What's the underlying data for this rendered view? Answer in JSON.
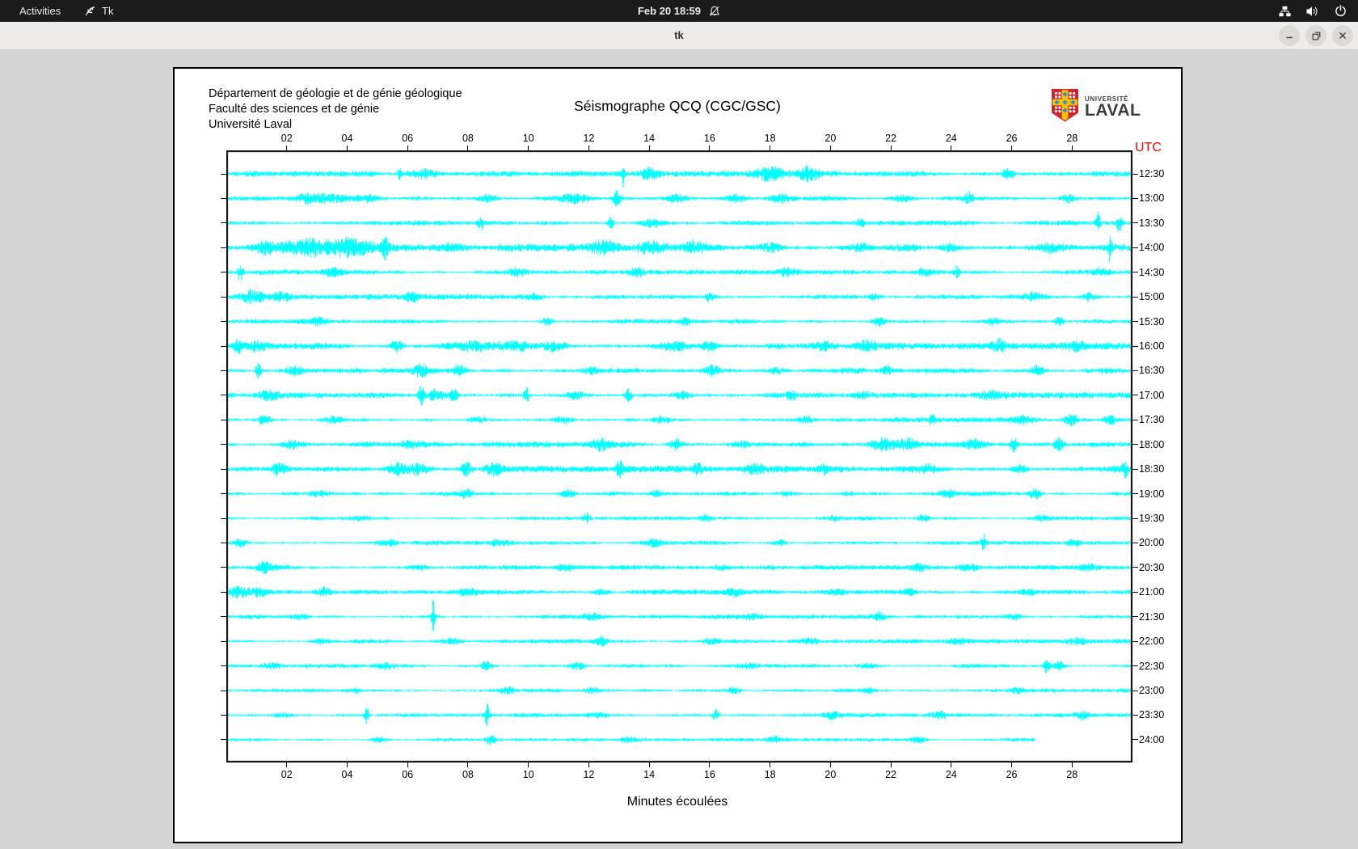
{
  "top_bar": {
    "activities": "Activities",
    "app_name": "Tk",
    "clock": "Feb 20 18:59",
    "icons": [
      "tk-icon",
      "notifications-muted-icon",
      "network-wired-icon",
      "volume-icon",
      "power-icon"
    ]
  },
  "titlebar": {
    "title": "tk",
    "buttons": [
      "minimize",
      "maximize",
      "close"
    ]
  },
  "seismograph": {
    "header_lines": [
      "Département de géologie et de génie géologique",
      "Faculté des sciences et de génie",
      "Université Laval"
    ],
    "title": "Séismographe QCQ (CGC/GSC)",
    "logo": {
      "line1": "UNIVERSITÉ",
      "line2": "LAVAL"
    },
    "utc_label": "UTC",
    "xlabel": "Minutes écoulées",
    "colors": {
      "trace": "#00ffff",
      "utc": "#f40000",
      "axis": "#000000",
      "logo_red": "#d5202e",
      "logo_gold": "#f6c101",
      "logo_blue": "#2792cc"
    }
  },
  "chart_data": {
    "type": "line",
    "title": "Séismographe QCQ (CGC/GSC)",
    "xlabel": "Minutes écoulées",
    "x_range": [
      0,
      30
    ],
    "x_ticks": [
      "02",
      "04",
      "06",
      "08",
      "10",
      "12",
      "14",
      "16",
      "18",
      "20",
      "22",
      "24",
      "26",
      "28"
    ],
    "utc_start": "12:30",
    "utc_end": "24:00",
    "minutes_per_line": 30,
    "rows": [
      {
        "label": "12:30",
        "amp": 2.4,
        "end": 30,
        "events": [
          [
            5.7,
            14,
            0.06
          ],
          [
            6.5,
            6,
            0.5
          ],
          [
            13.1,
            16,
            0.05
          ],
          [
            14.0,
            5,
            0.3
          ],
          [
            18.0,
            7,
            0.5
          ],
          [
            19.3,
            8,
            0.3
          ],
          [
            25.9,
            5,
            0.2
          ]
        ]
      },
      {
        "label": "13:00",
        "amp": 2.4,
        "end": 30,
        "events": [
          [
            2.6,
            5,
            0.4
          ],
          [
            3.4,
            6,
            0.5
          ],
          [
            4.6,
            5,
            0.4
          ],
          [
            8.6,
            4,
            0.3
          ],
          [
            11.5,
            6,
            0.5
          ],
          [
            12.9,
            9,
            0.15
          ],
          [
            14.9,
            5,
            0.4
          ],
          [
            16.9,
            5,
            0.3
          ],
          [
            18.4,
            5,
            0.3
          ],
          [
            22.4,
            4,
            0.3
          ],
          [
            24.6,
            7,
            0.15
          ],
          [
            27.9,
            5,
            0.2
          ]
        ]
      },
      {
        "label": "13:30",
        "amp": 2.1,
        "end": 30,
        "events": [
          [
            8.4,
            8,
            0.1
          ],
          [
            12.7,
            7,
            0.1
          ],
          [
            14.1,
            5,
            0.4
          ],
          [
            21.0,
            4,
            0.2
          ],
          [
            28.9,
            14,
            0.07
          ],
          [
            29.6,
            10,
            0.1
          ]
        ]
      },
      {
        "label": "14:00",
        "amp": 3.2,
        "end": 30,
        "events": [
          [
            1.2,
            6,
            0.4
          ],
          [
            2.5,
            8,
            0.8
          ],
          [
            4.0,
            9,
            0.7
          ],
          [
            5.2,
            12,
            0.12
          ],
          [
            7.5,
            5,
            0.5
          ],
          [
            12.5,
            7,
            0.6
          ],
          [
            14.0,
            6,
            0.4
          ],
          [
            15.5,
            6,
            0.3
          ],
          [
            18.0,
            5,
            0.4
          ],
          [
            21.0,
            5,
            0.3
          ],
          [
            24.0,
            5,
            0.3
          ],
          [
            27.3,
            5,
            0.3
          ],
          [
            29.3,
            16,
            0.06
          ]
        ]
      },
      {
        "label": "14:30",
        "amp": 2.1,
        "end": 30,
        "events": [
          [
            0.4,
            10,
            0.1
          ],
          [
            3.5,
            4,
            0.3
          ],
          [
            9.6,
            5,
            0.3
          ],
          [
            13.6,
            5,
            0.25
          ],
          [
            18.6,
            5,
            0.3
          ],
          [
            23.1,
            4,
            0.3
          ],
          [
            24.2,
            8,
            0.1
          ],
          [
            29.0,
            4,
            0.2
          ]
        ]
      },
      {
        "label": "15:00",
        "amp": 2.4,
        "end": 30,
        "events": [
          [
            0.8,
            7,
            0.4
          ],
          [
            1.8,
            5,
            0.3
          ],
          [
            6.1,
            5,
            0.2
          ],
          [
            10.2,
            4,
            0.25
          ],
          [
            16.0,
            4,
            0.2
          ],
          [
            21.4,
            4,
            0.2
          ],
          [
            26.8,
            5,
            0.3
          ],
          [
            28.6,
            5,
            0.25
          ]
        ]
      },
      {
        "label": "15:30",
        "amp": 2.1,
        "end": 30,
        "events": [
          [
            3.0,
            4,
            0.3
          ],
          [
            10.6,
            5,
            0.2
          ],
          [
            15.2,
            4,
            0.2
          ],
          [
            21.6,
            5,
            0.2
          ],
          [
            25.4,
            4,
            0.2
          ],
          [
            27.6,
            6,
            0.15
          ]
        ]
      },
      {
        "label": "16:00",
        "amp": 3.0,
        "end": 30,
        "events": [
          [
            0.3,
            8,
            0.15
          ],
          [
            1.0,
            6,
            0.3
          ],
          [
            5.6,
            7,
            0.2
          ],
          [
            8.0,
            5,
            0.8
          ],
          [
            9.5,
            6,
            0.6
          ],
          [
            10.8,
            6,
            0.4
          ],
          [
            14.8,
            5,
            0.5
          ],
          [
            16.0,
            5,
            0.3
          ],
          [
            19.8,
            5,
            0.4
          ],
          [
            21.2,
            5,
            0.3
          ],
          [
            25.6,
            6,
            0.2
          ],
          [
            28.2,
            4,
            0.3
          ]
        ]
      },
      {
        "label": "16:30",
        "amp": 2.4,
        "end": 30,
        "events": [
          [
            1.0,
            12,
            0.08
          ],
          [
            2.2,
            5,
            0.3
          ],
          [
            6.4,
            7,
            0.25
          ],
          [
            7.7,
            6,
            0.2
          ],
          [
            12.1,
            4,
            0.3
          ],
          [
            16.1,
            6,
            0.25
          ],
          [
            18.2,
            4,
            0.3
          ],
          [
            21.9,
            5,
            0.2
          ],
          [
            26.9,
            6,
            0.2
          ]
        ]
      },
      {
        "label": "17:00",
        "amp": 2.5,
        "end": 30,
        "events": [
          [
            1.3,
            5,
            0.3
          ],
          [
            6.4,
            14,
            0.1
          ],
          [
            6.9,
            7,
            0.3
          ],
          [
            7.5,
            8,
            0.15
          ],
          [
            9.9,
            11,
            0.08
          ],
          [
            11.5,
            5,
            0.3
          ],
          [
            13.3,
            8,
            0.12
          ],
          [
            15.1,
            4,
            0.3
          ],
          [
            18.7,
            7,
            0.15
          ],
          [
            21.2,
            4,
            0.3
          ],
          [
            25.3,
            5,
            0.4
          ]
        ]
      },
      {
        "label": "17:30",
        "amp": 2.1,
        "end": 30,
        "events": [
          [
            1.2,
            5,
            0.25
          ],
          [
            3.5,
            4,
            0.3
          ],
          [
            8.3,
            4,
            0.3
          ],
          [
            11.1,
            5,
            0.3
          ],
          [
            14.4,
            4,
            0.3
          ],
          [
            19.2,
            4,
            0.25
          ],
          [
            23.4,
            8,
            0.1
          ],
          [
            26.4,
            4,
            0.3
          ],
          [
            28.0,
            7,
            0.2
          ],
          [
            29.3,
            6,
            0.2
          ]
        ]
      },
      {
        "label": "18:00",
        "amp": 2.4,
        "end": 30,
        "events": [
          [
            2.1,
            4,
            0.3
          ],
          [
            6.1,
            4,
            0.3
          ],
          [
            12.4,
            7,
            0.3
          ],
          [
            14.9,
            6,
            0.2
          ],
          [
            17.0,
            4,
            0.3
          ],
          [
            21.7,
            7,
            0.4
          ],
          [
            22.6,
            6,
            0.3
          ],
          [
            24.8,
            5,
            0.3
          ],
          [
            26.1,
            8,
            0.12
          ],
          [
            27.6,
            7,
            0.15
          ]
        ]
      },
      {
        "label": "18:30",
        "amp": 2.8,
        "end": 30,
        "events": [
          [
            1.7,
            6,
            0.25
          ],
          [
            5.6,
            8,
            0.3
          ],
          [
            6.3,
            7,
            0.4
          ],
          [
            7.9,
            8,
            0.2
          ],
          [
            8.8,
            6,
            0.3
          ],
          [
            13.0,
            9,
            0.12
          ],
          [
            15.6,
            7,
            0.15
          ],
          [
            17.5,
            5,
            0.3
          ],
          [
            19.8,
            6,
            0.15
          ],
          [
            23.3,
            4,
            0.3
          ],
          [
            26.3,
            5,
            0.25
          ],
          [
            29.8,
            9,
            0.1
          ]
        ]
      },
      {
        "label": "19:00",
        "amp": 2.0,
        "end": 30,
        "events": [
          [
            3.0,
            3,
            0.3
          ],
          [
            7.9,
            5,
            0.2
          ],
          [
            11.3,
            4,
            0.25
          ],
          [
            14.2,
            4,
            0.2
          ],
          [
            18.6,
            3,
            0.3
          ],
          [
            23.9,
            4,
            0.2
          ],
          [
            26.8,
            6,
            0.2
          ]
        ]
      },
      {
        "label": "19:30",
        "amp": 1.8,
        "end": 30,
        "events": [
          [
            4.4,
            3,
            0.3
          ],
          [
            11.9,
            8,
            0.1
          ],
          [
            15.9,
            4,
            0.2
          ],
          [
            20.1,
            3,
            0.25
          ],
          [
            23.1,
            4,
            0.2
          ],
          [
            27.0,
            3,
            0.3
          ]
        ]
      },
      {
        "label": "20:00",
        "amp": 2.0,
        "end": 30,
        "events": [
          [
            0.4,
            6,
            0.2
          ],
          [
            5.3,
            3,
            0.3
          ],
          [
            9.0,
            3,
            0.25
          ],
          [
            14.1,
            3,
            0.3
          ],
          [
            18.3,
            4,
            0.2
          ],
          [
            25.1,
            10,
            0.08
          ],
          [
            28.1,
            4,
            0.2
          ]
        ]
      },
      {
        "label": "20:30",
        "amp": 2.0,
        "end": 30,
        "events": [
          [
            1.2,
            6,
            0.25
          ],
          [
            6.3,
            3,
            0.3
          ],
          [
            11.2,
            3,
            0.3
          ],
          [
            16.4,
            3,
            0.3
          ],
          [
            22.9,
            4,
            0.25
          ],
          [
            24.6,
            4,
            0.3
          ],
          [
            28.6,
            3,
            0.3
          ]
        ]
      },
      {
        "label": "21:00",
        "amp": 2.2,
        "end": 30,
        "events": [
          [
            0.3,
            7,
            0.3
          ],
          [
            1.0,
            5,
            0.4
          ],
          [
            3.2,
            5,
            0.25
          ],
          [
            8.0,
            3,
            0.3
          ],
          [
            12.4,
            3,
            0.3
          ],
          [
            16.8,
            4,
            0.25
          ],
          [
            20.2,
            3,
            0.3
          ],
          [
            22.6,
            4,
            0.25
          ],
          [
            26.6,
            3,
            0.3
          ]
        ]
      },
      {
        "label": "21:30",
        "amp": 1.8,
        "end": 30,
        "events": [
          [
            2.4,
            3,
            0.3
          ],
          [
            6.8,
            20,
            0.06
          ],
          [
            12.1,
            3,
            0.3
          ],
          [
            17.3,
            3,
            0.3
          ],
          [
            21.6,
            5,
            0.2
          ],
          [
            26.1,
            3,
            0.3
          ]
        ]
      },
      {
        "label": "22:00",
        "amp": 1.8,
        "end": 30,
        "events": [
          [
            3.1,
            3,
            0.3
          ],
          [
            7.4,
            3,
            0.3
          ],
          [
            12.4,
            5,
            0.2
          ],
          [
            16.1,
            3,
            0.3
          ],
          [
            19.3,
            4,
            0.25
          ],
          [
            24.3,
            3,
            0.3
          ],
          [
            28.2,
            3,
            0.3
          ]
        ]
      },
      {
        "label": "22:30",
        "amp": 1.8,
        "end": 30,
        "events": [
          [
            1.4,
            3,
            0.3
          ],
          [
            5.2,
            3,
            0.3
          ],
          [
            8.6,
            5,
            0.2
          ],
          [
            11.6,
            4,
            0.25
          ],
          [
            17.3,
            3,
            0.3
          ],
          [
            21.2,
            3,
            0.3
          ],
          [
            27.2,
            9,
            0.1
          ],
          [
            27.6,
            5,
            0.2
          ]
        ]
      },
      {
        "label": "23:00",
        "amp": 1.6,
        "end": 30,
        "events": [
          [
            4.2,
            3,
            0.25
          ],
          [
            9.3,
            3,
            0.25
          ],
          [
            12.1,
            3,
            0.25
          ],
          [
            16.8,
            4,
            0.2
          ],
          [
            21.3,
            3,
            0.25
          ],
          [
            26.2,
            3,
            0.25
          ]
        ]
      },
      {
        "label": "23:30",
        "amp": 1.8,
        "end": 30,
        "events": [
          [
            1.8,
            3,
            0.3
          ],
          [
            4.6,
            10,
            0.08
          ],
          [
            8.6,
            14,
            0.07
          ],
          [
            12.3,
            3,
            0.3
          ],
          [
            16.2,
            8,
            0.1
          ],
          [
            20.1,
            4,
            0.25
          ],
          [
            23.6,
            4,
            0.25
          ],
          [
            28.4,
            4,
            0.2
          ]
        ]
      },
      {
        "label": "24:00",
        "amp": 1.4,
        "end": 26.8,
        "events": [
          [
            5.0,
            3,
            0.25
          ],
          [
            8.7,
            6,
            0.15
          ],
          [
            13.3,
            3,
            0.25
          ],
          [
            18.2,
            3,
            0.25
          ],
          [
            22.9,
            3,
            0.25
          ]
        ]
      }
    ]
  }
}
